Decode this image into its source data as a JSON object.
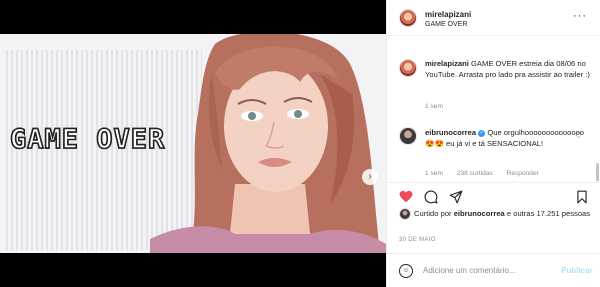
{
  "post": {
    "image": {
      "overlay_text": "GAME OVER",
      "carousel_dots": 2,
      "active_dot": 1
    },
    "author": {
      "username": "mirelapizani",
      "subtitle": "GAME OVER"
    },
    "caption": {
      "username": "mirelapizani",
      "text": "GAME OVER estreia dia 08/06 no YouTube. Arrasta pro lado pra assistir ao trailer :)",
      "time": "1 sem"
    },
    "comments": [
      {
        "username": "eibrunocorrea",
        "verified": true,
        "text": "Que orgulhoooooooooooooo 😍😍 eu já vi e tá SENSACIONAL!",
        "time": "1 sem",
        "likes": "238 curtidas",
        "reply_label": "Responder"
      }
    ],
    "likes_text": {
      "prefix": "Curtido por",
      "user": "eibrunocorrea",
      "suffix": "e outras 17.251 pessoas"
    },
    "date": "30 DE MAIO",
    "comment_input": {
      "placeholder": "Adicione um comentário...",
      "submit_label": "Publicar"
    }
  },
  "colors": {
    "like_red": "#ed4956",
    "link_blue": "#b2dffc",
    "verified_blue": "#3897f0"
  }
}
